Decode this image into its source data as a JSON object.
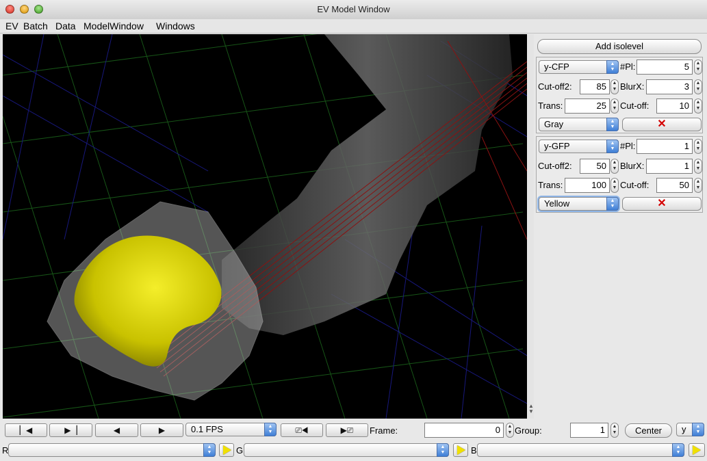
{
  "window": {
    "title": "EV Model Window"
  },
  "menu": [
    "EV",
    "Batch",
    "Data",
    "ModelWindow",
    "Windows"
  ],
  "panel": {
    "add_isolevel": "Add isolevel",
    "isolevels": [
      {
        "channel": "y-CFP",
        "pl_label": "#Pl:",
        "pl": "5",
        "cutoff2_label": "Cut-off2:",
        "cutoff2": "85",
        "blurx_label": "BlurX:",
        "blurx": "3",
        "trans_label": "Trans:",
        "trans": "25",
        "cutoff_label": "Cut-off:",
        "cutoff": "10",
        "color": "Gray"
      },
      {
        "channel": "y-GFP",
        "pl_label": "#Pl:",
        "pl": "1",
        "cutoff2_label": "Cut-off2:",
        "cutoff2": "50",
        "blurx_label": "BlurX:",
        "blurx": "1",
        "trans_label": "Trans:",
        "trans": "100",
        "cutoff_label": "Cut-off:",
        "cutoff": "50",
        "color": "Yellow"
      }
    ]
  },
  "transport": {
    "fps": "0.1 FPS",
    "frame_label": "Frame:",
    "frame": "0",
    "group_label": "Group:",
    "group": "1",
    "center": "Center",
    "axis": "y"
  },
  "channels": {
    "r_label": "R",
    "g_label": "G",
    "b_label": "B"
  },
  "icons": {
    "delete": "x-delete-icon",
    "play": "play-icon"
  }
}
